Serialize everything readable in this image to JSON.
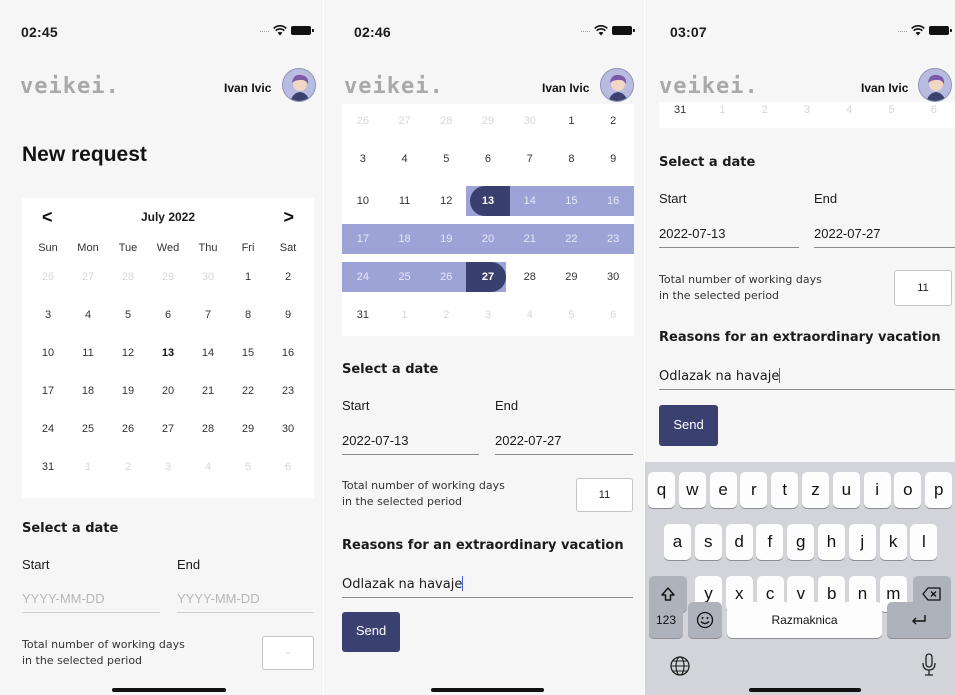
{
  "screens": [
    {
      "time": "02:45",
      "logo": "veikei.",
      "user_name": "Ivan Ivic",
      "title": "New request",
      "calendar": {
        "month_label": "July 2022",
        "prev": "<",
        "next": ">",
        "weekdays": [
          "Sun",
          "Mon",
          "Tue",
          "Wed",
          "Thu",
          "Fri",
          "Sat"
        ],
        "weeks": [
          [
            "26",
            "27",
            "28",
            "29",
            "30",
            "1",
            "2"
          ],
          [
            "3",
            "4",
            "5",
            "6",
            "7",
            "8",
            "9"
          ],
          [
            "10",
            "11",
            "12",
            "13",
            "14",
            "15",
            "16"
          ],
          [
            "17",
            "18",
            "19",
            "20",
            "21",
            "22",
            "23"
          ],
          [
            "24",
            "25",
            "26",
            "27",
            "28",
            "29",
            "30"
          ],
          [
            "31",
            "1",
            "2",
            "3",
            "4",
            "5",
            "6"
          ]
        ],
        "today": "13"
      },
      "select_date_label": "Select a date",
      "start_label": "Start",
      "end_label": "End",
      "start_placeholder": "YYYY-MM-DD",
      "end_placeholder": "YYYY-MM-DD",
      "working_days_label_1": "Total number of working days",
      "working_days_label_2": "in the selected period",
      "working_days_value": "-"
    },
    {
      "time": "02:46",
      "logo": "veikei.",
      "user_name": "Ivan Ivic",
      "calendar": {
        "weeks": [
          [
            "26",
            "27",
            "28",
            "29",
            "30",
            "1",
            "2"
          ],
          [
            "3",
            "4",
            "5",
            "6",
            "7",
            "8",
            "9"
          ],
          [
            "10",
            "11",
            "12",
            "13",
            "14",
            "15",
            "16"
          ],
          [
            "17",
            "18",
            "19",
            "20",
            "21",
            "22",
            "23"
          ],
          [
            "24",
            "25",
            "26",
            "27",
            "28",
            "29",
            "30"
          ],
          [
            "31",
            "1",
            "2",
            "3",
            "4",
            "5",
            "6"
          ]
        ],
        "range_start": "13",
        "range_end": "27"
      },
      "select_date_label": "Select a date",
      "start_label": "Start",
      "end_label": "End",
      "start_value": "2022-07-13",
      "end_value": "2022-07-27",
      "working_days_label_1": "Total number of working days",
      "working_days_label_2": "in the selected period",
      "working_days_value": "11",
      "reason_title": "Reasons for an extraordinary vacation",
      "reason_value": "Odlazak na havaje",
      "send_label": "Send"
    },
    {
      "time": "03:07",
      "logo": "veikei.",
      "user_name": "Ivan Ivic",
      "calendar_last_row": [
        "31",
        "1",
        "2",
        "3",
        "4",
        "5",
        "6"
      ],
      "select_date_label": "Select a date",
      "start_label": "Start",
      "end_label": "End",
      "start_value": "2022-07-13",
      "end_value": "2022-07-27",
      "working_days_label_1": "Total number of working days",
      "working_days_label_2": "in the selected period",
      "working_days_value": "11",
      "reason_title": "Reasons for an extraordinary vacation",
      "reason_value": "Odlazak na havaje",
      "send_label": "Send",
      "keyboard": {
        "row1": [
          "q",
          "w",
          "e",
          "r",
          "t",
          "z",
          "u",
          "i",
          "o",
          "p"
        ],
        "row2": [
          "a",
          "s",
          "d",
          "f",
          "g",
          "h",
          "j",
          "k",
          "l"
        ],
        "row3": [
          "y",
          "x",
          "c",
          "v",
          "b",
          "n",
          "m"
        ],
        "numbers_key": "123",
        "space_label": "Razmaknica",
        "shift_icon": "shift-icon",
        "backspace_icon": "backspace-icon",
        "return_icon": "return-icon",
        "emoji_icon": "emoji-icon",
        "globe_icon": "globe-icon",
        "mic_icon": "microphone-icon"
      }
    }
  ],
  "colors": {
    "accent": "#39406d",
    "range": "#9ea3d7",
    "background": "#f6f6f6"
  }
}
